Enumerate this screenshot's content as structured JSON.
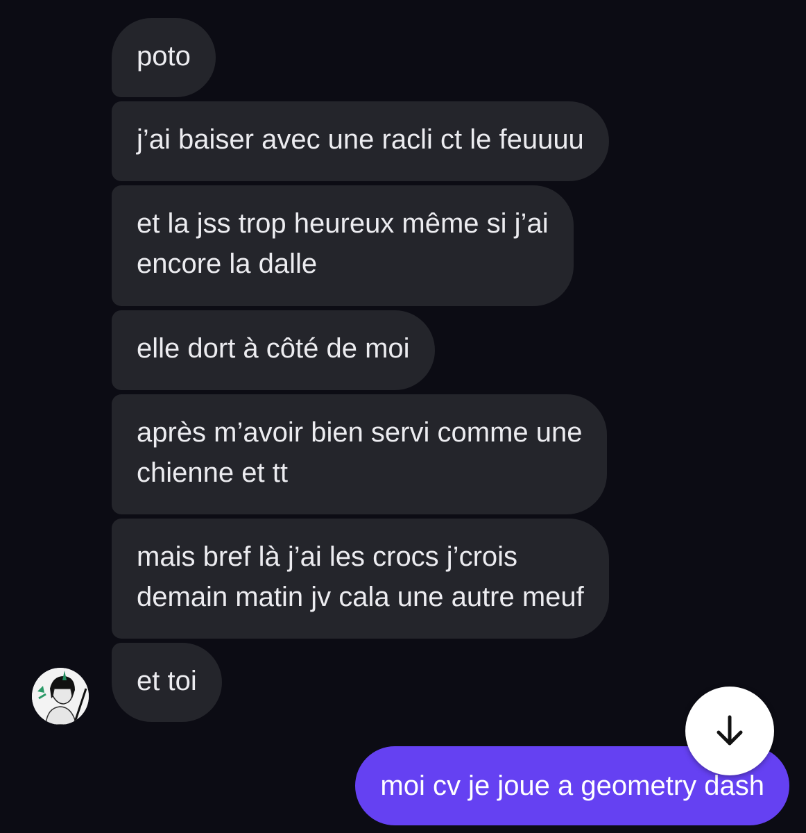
{
  "messages": {
    "received": [
      "poto",
      "j’ai baiser avec une racli ct le feuuuu",
      "et la jss trop heureux même si j’ai\nencore la dalle",
      "elle dort à côté de moi",
      "après m’avoir bien servi comme une\nchienne et tt",
      "mais bref là j’ai les crocs j’crois\ndemain matin jv cala une autre meuf",
      "et toi"
    ],
    "sent": [
      "moi cv je joue a geometry dash"
    ]
  },
  "icons": {
    "avatar": "contact-avatar",
    "scroll_button": "arrow-down-icon"
  },
  "colors": {
    "background": "#0c0c14",
    "received_bubble": "#24252b",
    "sent_bubble": "#6541f2",
    "text": "#ececf0"
  }
}
